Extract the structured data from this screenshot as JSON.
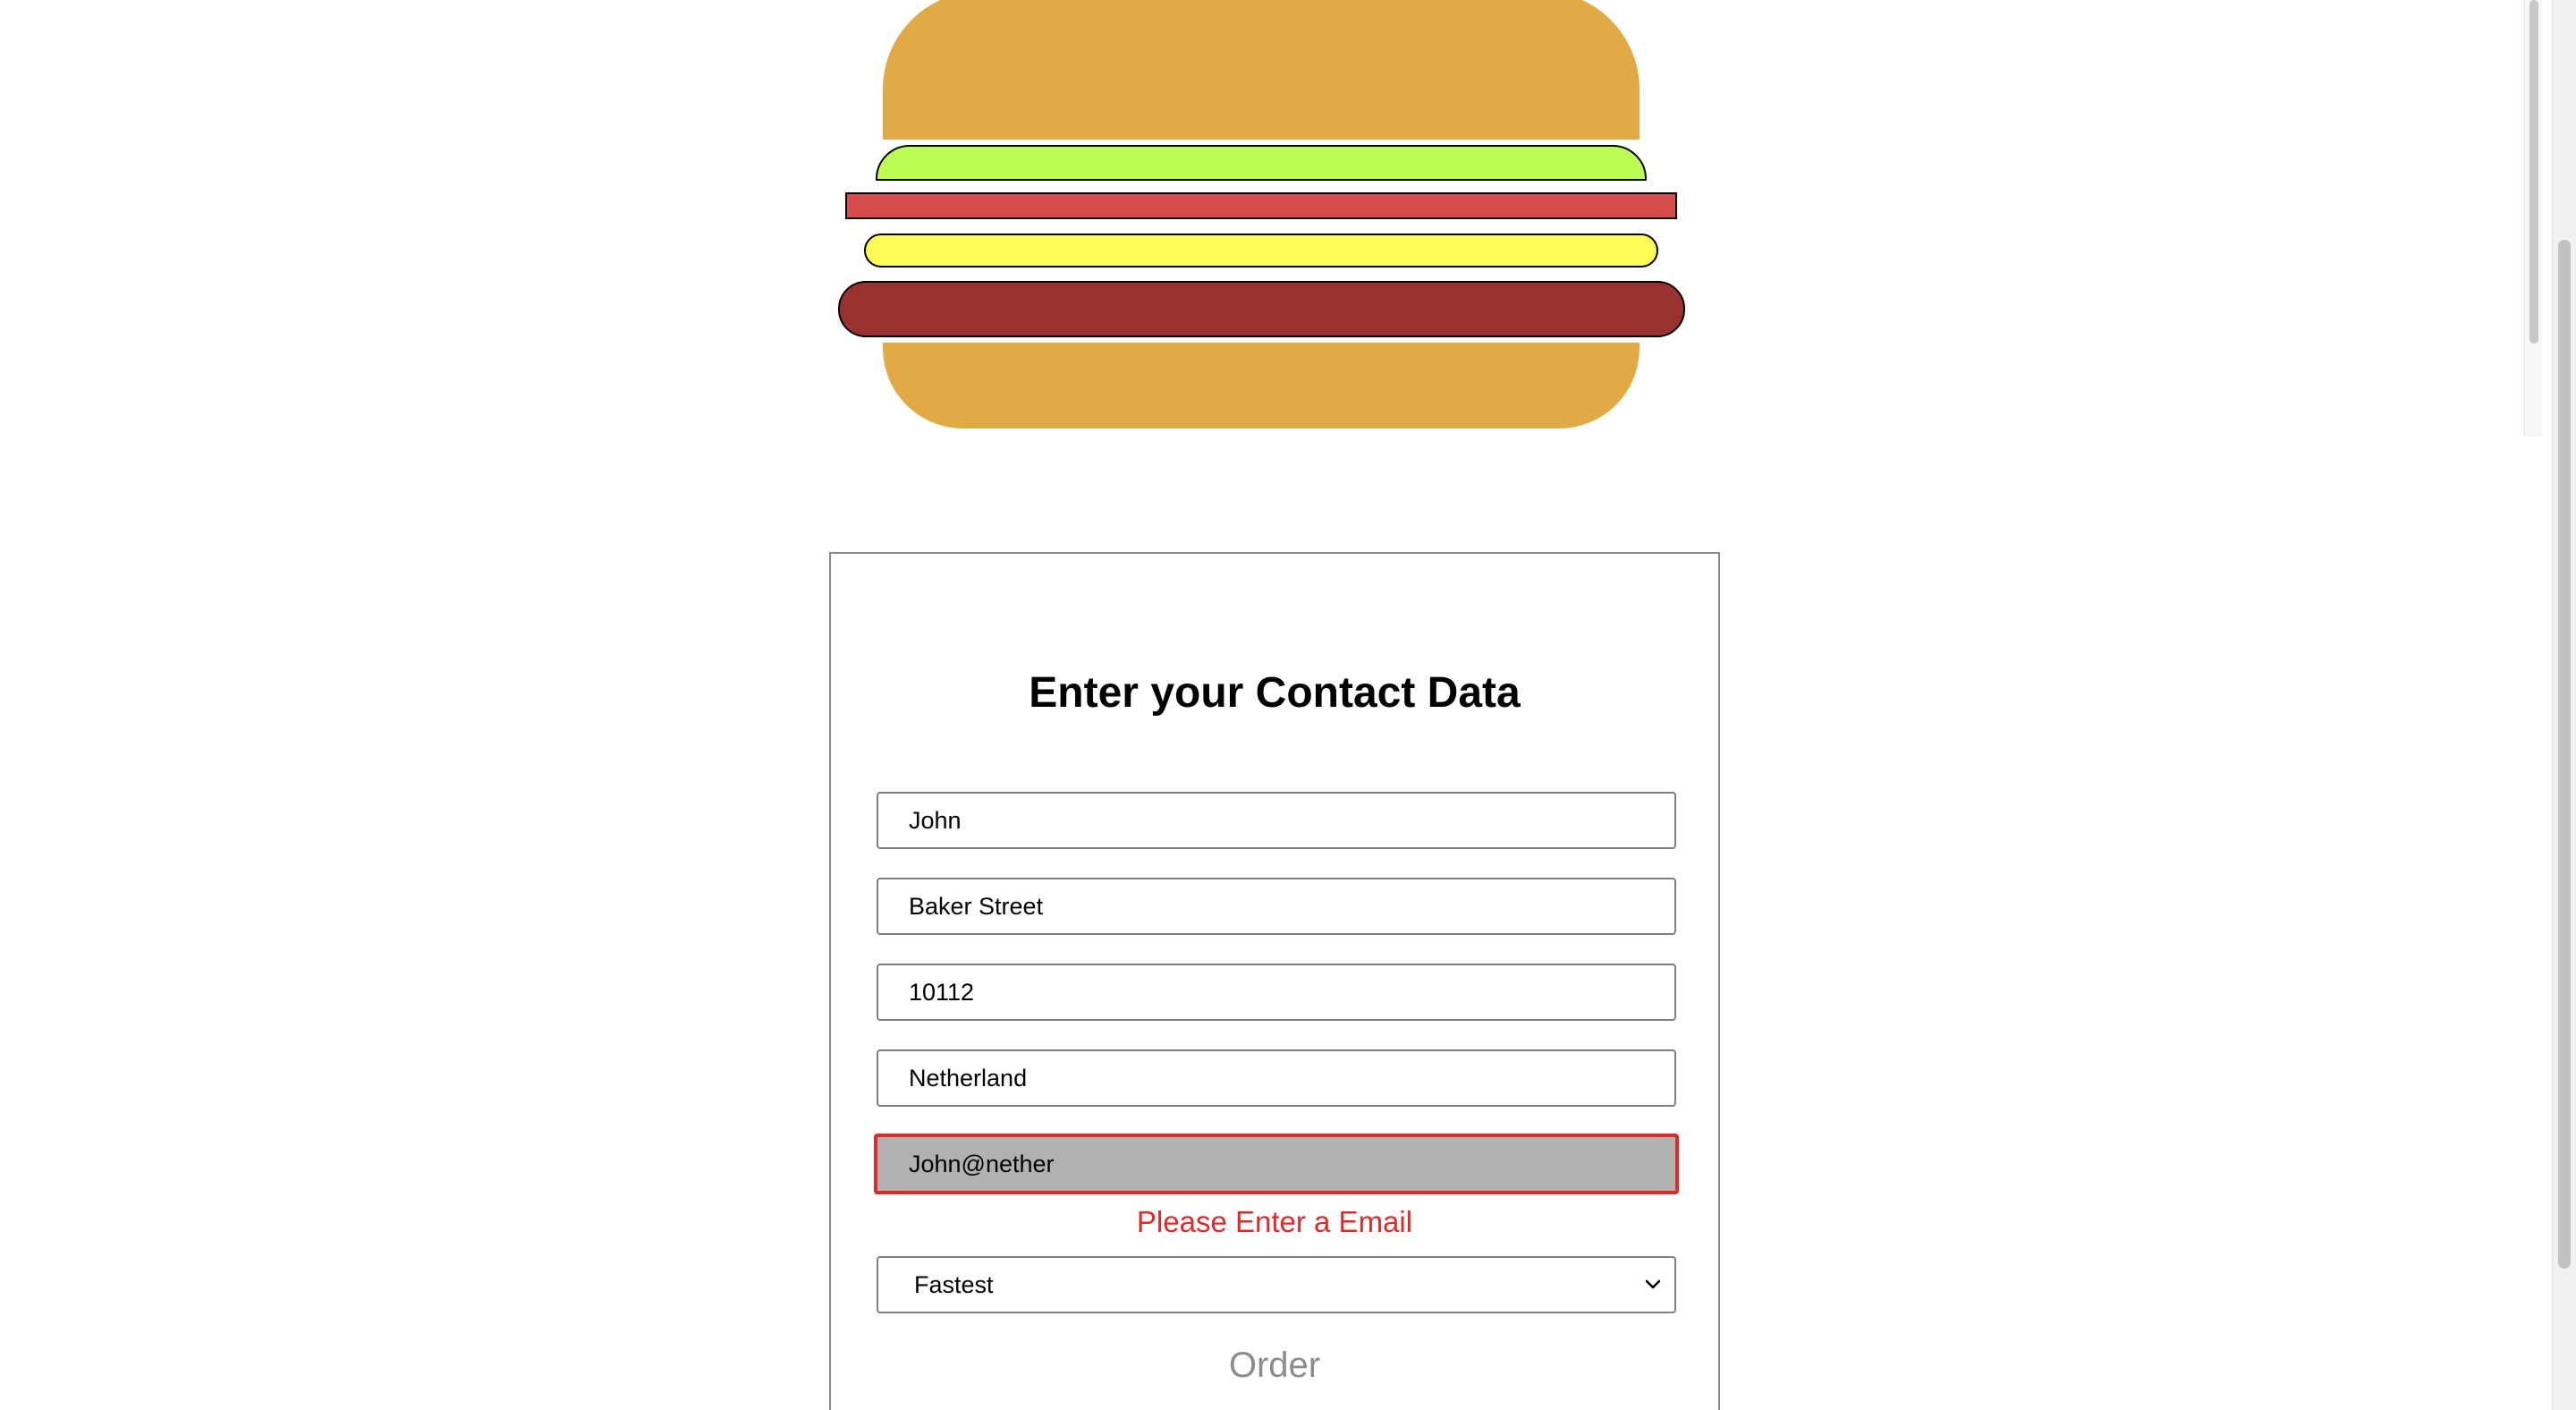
{
  "form": {
    "title": "Enter your Contact Data",
    "fields": [
      {
        "value": "John"
      },
      {
        "value": "Baker Street"
      },
      {
        "value": "10112"
      },
      {
        "value": "Netherland"
      },
      {
        "value": "John@nether"
      }
    ],
    "error_message": "Please Enter a Email",
    "delivery_select": {
      "selected": "Fastest"
    },
    "order_label": "Order"
  },
  "colors": {
    "bread": "#e1aa45",
    "lettuce": "#bdfc55",
    "tomato": "#d64c4c",
    "cheese": "#fffd55",
    "meat": "#993131",
    "error": "#e02a2a",
    "invalid_field_bg": "#b1b1b1",
    "disabled_text": "#8c8c8c"
  },
  "icons": {
    "select_arrow": "chevron-down-icon"
  }
}
